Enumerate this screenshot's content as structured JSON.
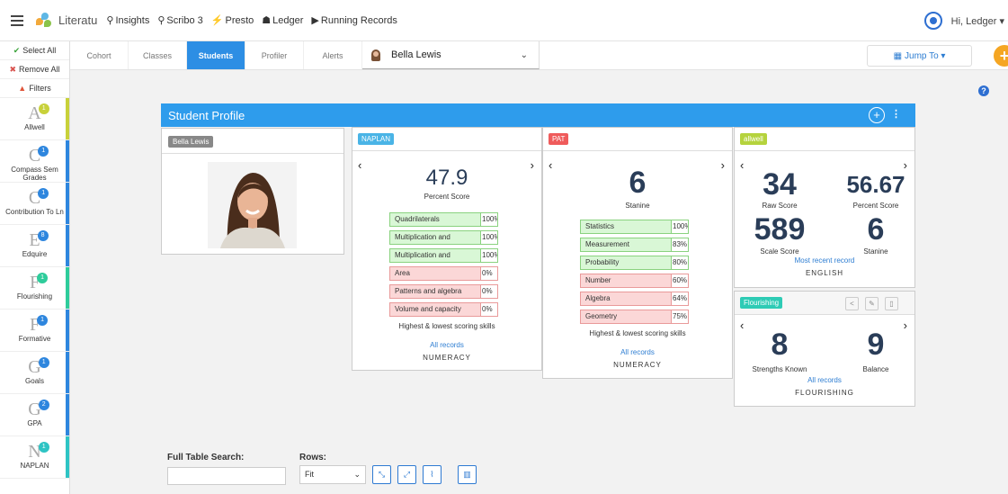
{
  "topbar": {
    "brand": "Literatu",
    "nav": [
      {
        "icon": "bulb-icon",
        "glyph": "⚲",
        "label": "Insights"
      },
      {
        "icon": "bulb-icon",
        "glyph": "⚲",
        "label": "Scribo 3"
      },
      {
        "icon": "wand-icon",
        "glyph": "⚡",
        "label": "Presto"
      },
      {
        "icon": "sitemap-icon",
        "glyph": "☗",
        "label": "Ledger"
      },
      {
        "icon": "play-icon",
        "glyph": "▶",
        "label": "Running Records"
      }
    ],
    "user": "Hi, Ledger ▾"
  },
  "sidebar": {
    "select_all": "Select All",
    "remove_all": "Remove All",
    "filters": "Filters",
    "items": [
      {
        "letter": "A",
        "badge": "1",
        "label": "Allwell",
        "badge_color": "#c8d13a",
        "bar_color": "#c8d13a"
      },
      {
        "letter": "C",
        "badge": "1",
        "label": "Compass Sem Grades",
        "badge_color": "#2e86de",
        "bar_color": "#2e86de"
      },
      {
        "letter": "C",
        "badge": "1",
        "label": "Contribution To Ln",
        "badge_color": "#2e86de",
        "bar_color": "#2e86de"
      },
      {
        "letter": "E",
        "badge": "8",
        "label": "Edquire",
        "badge_color": "#2e86de",
        "bar_color": "#2e86de"
      },
      {
        "letter": "F",
        "badge": "1",
        "label": "Flourishing",
        "badge_color": "#2ecc9b",
        "bar_color": "#2ecc9b"
      },
      {
        "letter": "F",
        "badge": "1",
        "label": "Formative",
        "badge_color": "#2e86de",
        "bar_color": "#2e86de"
      },
      {
        "letter": "G",
        "badge": "1",
        "label": "Goals",
        "badge_color": "#2e86de",
        "bar_color": "#2e86de"
      },
      {
        "letter": "G",
        "badge": "2",
        "label": "GPA",
        "badge_color": "#2e86de",
        "bar_color": "#2e86de"
      },
      {
        "letter": "N",
        "badge": "1",
        "label": "NAPLAN",
        "badge_color": "#2ec4c4",
        "bar_color": "#2ec4c4"
      }
    ]
  },
  "tabs": [
    "Cohort",
    "Classes",
    "Students",
    "Profiler",
    "Alerts"
  ],
  "active_tab": "Students",
  "student_select": {
    "value": "Bella Lewis"
  },
  "jump_to": "Jump To ▾",
  "profile": {
    "title": "Student Profile",
    "name_tag": "Bella Lewis"
  },
  "naplan": {
    "tag": "NAPLAN",
    "tag_color": "#4ab4e6",
    "score": "47.9",
    "score_label": "Percent Score",
    "skills": [
      {
        "name": "Quadrilaterals",
        "pct": "100%",
        "level": "hi"
      },
      {
        "name": "Multiplication and",
        "pct": "100%",
        "level": "hi"
      },
      {
        "name": "Multiplication and",
        "pct": "100%",
        "level": "hi"
      },
      {
        "name": "Area",
        "pct": "0%",
        "level": "lo"
      },
      {
        "name": "Patterns and algebra",
        "pct": "0%",
        "level": "lo"
      },
      {
        "name": "Volume and capacity",
        "pct": "0%",
        "level": "lo"
      }
    ],
    "skills_caption": "Highest & lowest scoring skills",
    "link": "All records",
    "domain": "NUMERACY"
  },
  "pat": {
    "tag": "PAT",
    "tag_color": "#ef5b5b",
    "score": "6",
    "score_label": "Stanine",
    "skills": [
      {
        "name": "Statistics",
        "pct": "100%",
        "level": "hi"
      },
      {
        "name": "Measurement",
        "pct": "83%",
        "level": "hi"
      },
      {
        "name": "Probability",
        "pct": "80%",
        "level": "hi"
      },
      {
        "name": "Number",
        "pct": "60%",
        "level": "lo"
      },
      {
        "name": "Algebra",
        "pct": "64%",
        "level": "lo"
      },
      {
        "name": "Geometry",
        "pct": "75%",
        "level": "lo"
      }
    ],
    "skills_caption": "Highest & lowest scoring skills",
    "link": "All records",
    "domain": "NUMERACY"
  },
  "allwell": {
    "tag": "allwell",
    "tag_color": "#b5d33d",
    "raw_score": "34",
    "raw_label": "Raw Score",
    "percent_score": "56.67",
    "percent_label": "Percent Score",
    "scale_score": "589",
    "scale_label": "Scale Score",
    "stanine": "6",
    "stanine_label": "Stanine",
    "link": "Most recent record",
    "domain": "ENGLISH"
  },
  "flourishing": {
    "tag": "Flourishing",
    "tag_color": "#2ecbb5",
    "strengths": "8",
    "strengths_label": "Strengths Known",
    "balance": "9",
    "balance_label": "Balance",
    "link": "All records",
    "domain": "FLOURISHING"
  },
  "bottom": {
    "search_label": "Full Table Search:",
    "search_value": "",
    "rows_label": "Rows:",
    "rows_value": "Fit"
  }
}
